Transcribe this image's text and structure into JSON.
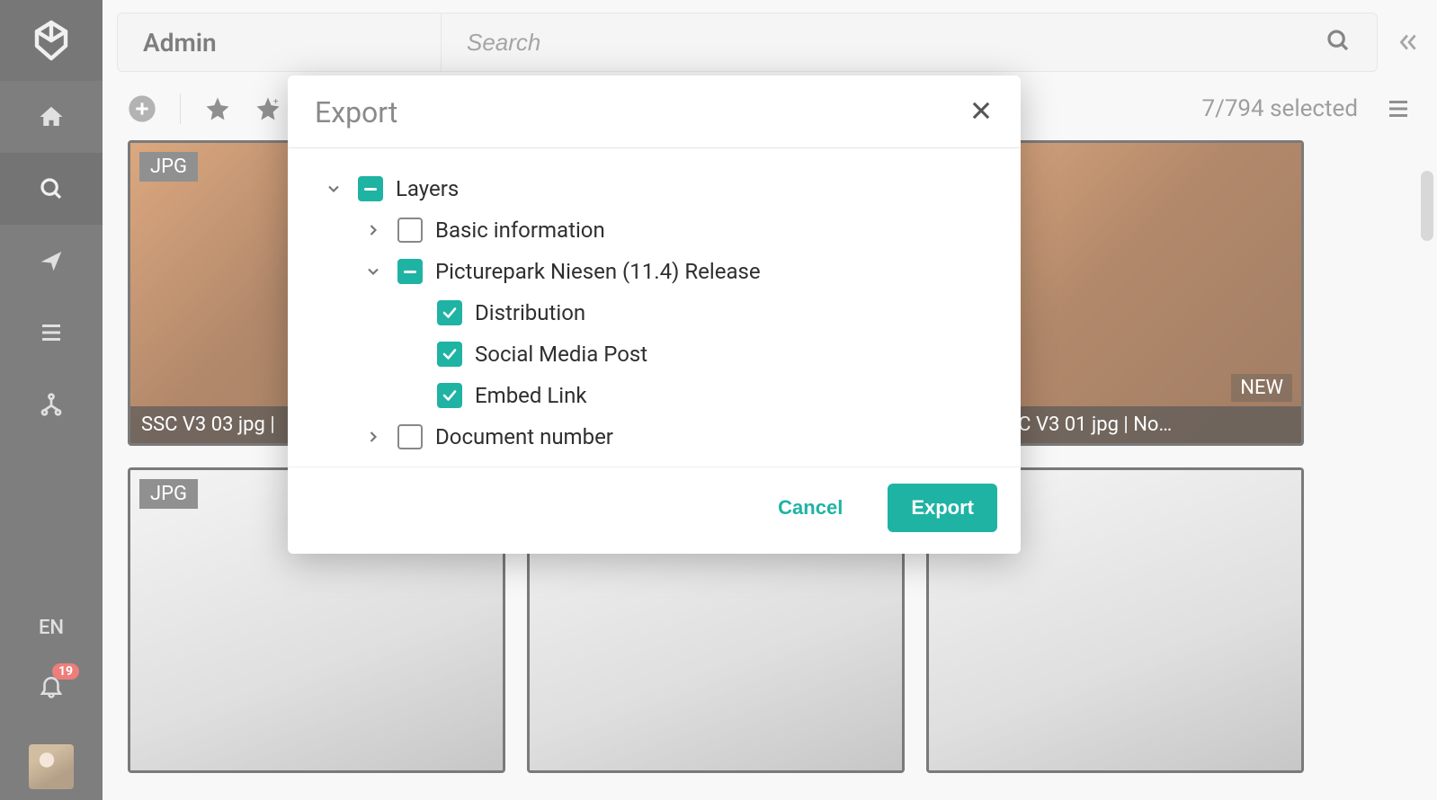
{
  "header": {
    "title": "Admin",
    "search_placeholder": "Search"
  },
  "toolbar": {
    "selection_count": "7/794 selected"
  },
  "rail": {
    "lang": "EN",
    "badge": "19"
  },
  "cards": [
    {
      "type": "JPG",
      "caption": "SSC V3 03 jpg | ",
      "variant": "warm",
      "new": false
    },
    {
      "type": "",
      "caption": "",
      "variant": "grey",
      "new": false
    },
    {
      "type": "",
      "caption": "anger SSC V3 01 jpg | No…",
      "variant": "warm",
      "new": true
    },
    {
      "type": "JPG",
      "caption": "",
      "variant": "grey",
      "new": false
    },
    {
      "type": "",
      "caption": "",
      "variant": "grey",
      "new": false
    },
    {
      "type": "",
      "caption": "",
      "variant": "grey",
      "new": false
    }
  ],
  "dialog": {
    "title": "Export",
    "cancel": "Cancel",
    "export": "Export",
    "tree": {
      "root": {
        "label": "Layers",
        "state": "indet",
        "expanded": true
      },
      "children": [
        {
          "label": "Basic information",
          "state": "unchecked",
          "expandable": true,
          "expanded": false
        },
        {
          "label": "Picturepark Niesen (11.4) Release",
          "state": "indet",
          "expandable": true,
          "expanded": true,
          "children": [
            {
              "label": "Distribution",
              "state": "checked"
            },
            {
              "label": "Social Media Post",
              "state": "checked"
            },
            {
              "label": "Embed Link",
              "state": "checked"
            }
          ]
        },
        {
          "label": "Document number",
          "state": "unchecked",
          "expandable": true,
          "expanded": false
        }
      ]
    }
  }
}
